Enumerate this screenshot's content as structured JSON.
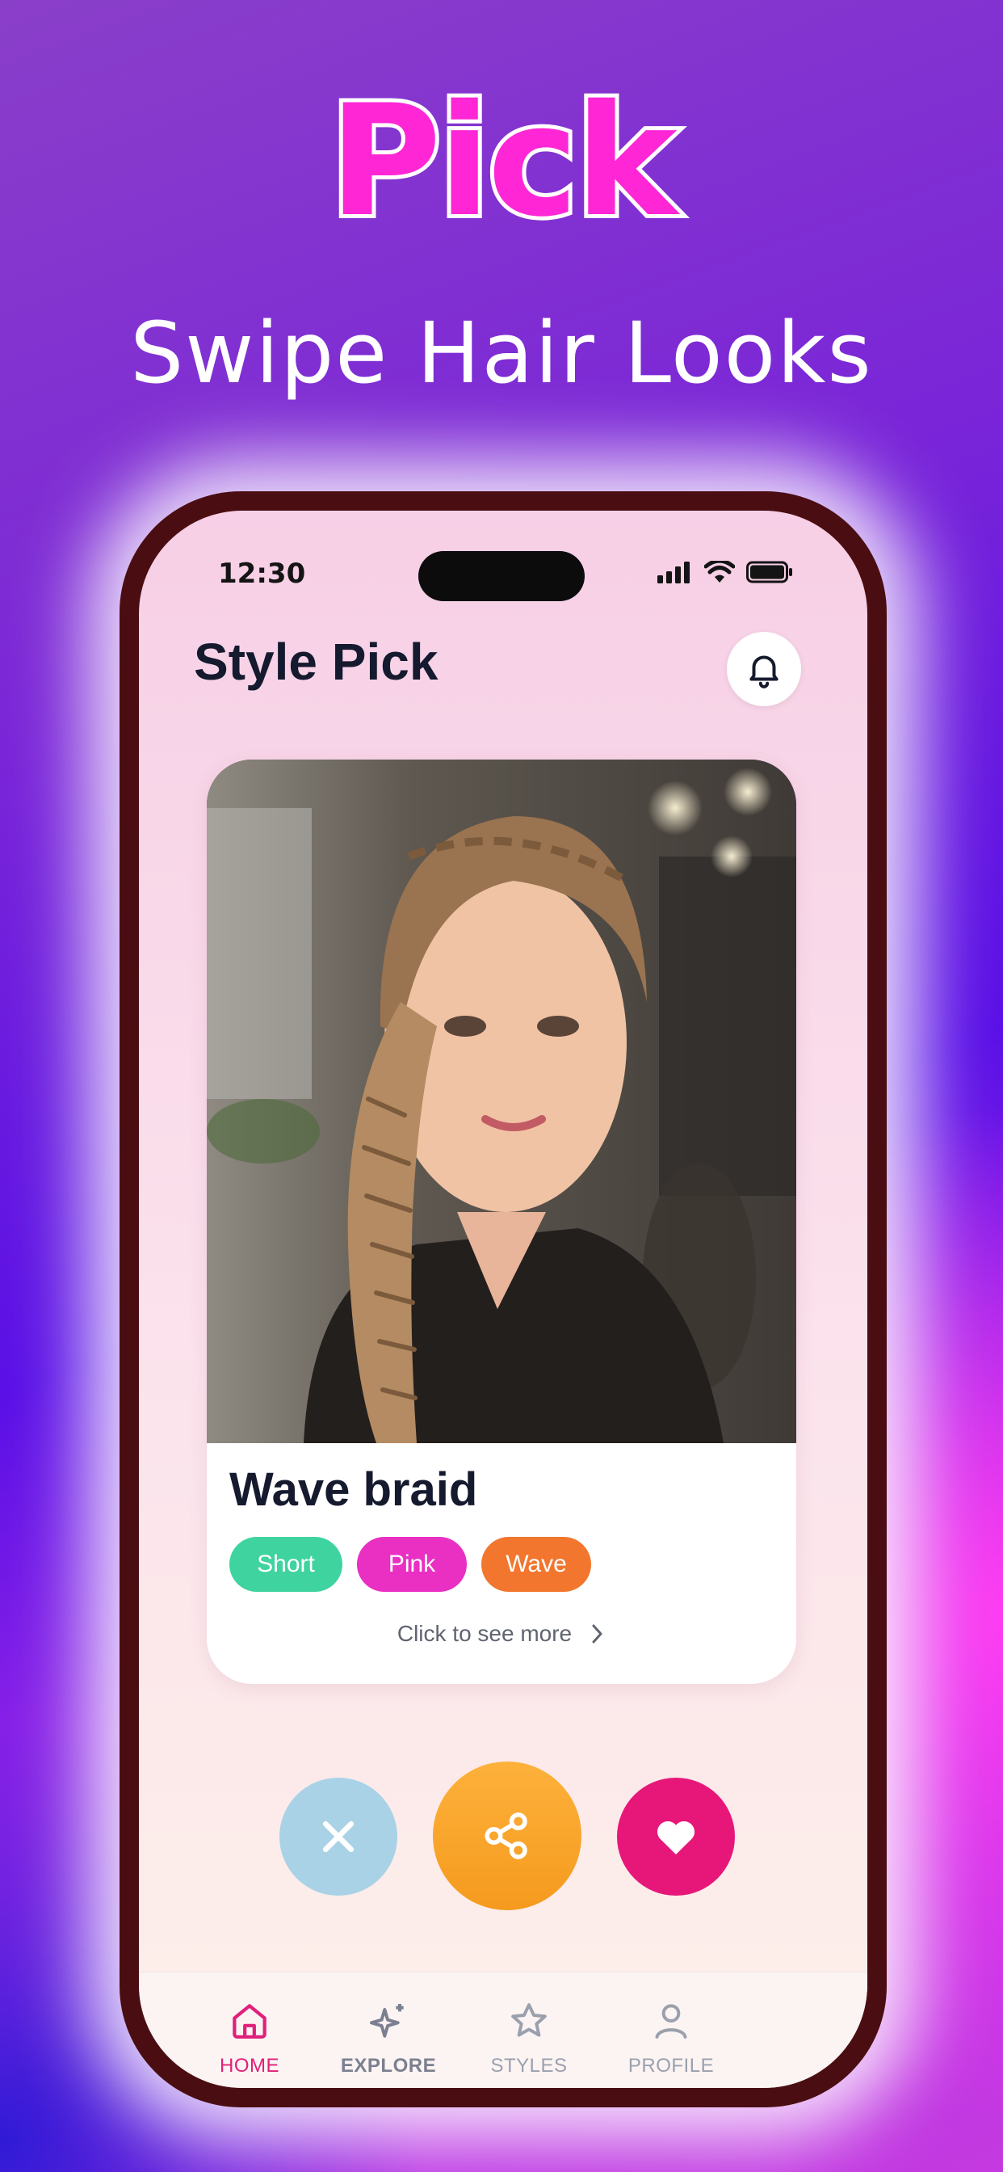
{
  "promo": {
    "title": "Pick",
    "subtitle": "Swipe Hair Looks"
  },
  "status_bar": {
    "time": "12:30",
    "icons": [
      "signal-icon",
      "wifi-icon",
      "battery-icon"
    ]
  },
  "header": {
    "title": "Style Pick",
    "notification_icon": "bell-icon"
  },
  "card": {
    "style_name": "Wave braid",
    "tags": [
      {
        "label": "Short",
        "color": "#3fd3a0"
      },
      {
        "label": "Pink",
        "color": "#ea2fc3"
      },
      {
        "label": "Wave",
        "color": "#f2762e"
      }
    ],
    "see_more_label": "Click to see more",
    "see_more_icon": "chevron-right-icon"
  },
  "actions": {
    "skip_icon": "close-icon",
    "share_icon": "share-icon",
    "like_icon": "heart-icon"
  },
  "tab_bar": {
    "items": [
      {
        "label": "HOME",
        "icon": "home-icon",
        "active": true
      },
      {
        "label": "EXPLORE",
        "icon": "sparkles-icon",
        "active": false
      },
      {
        "label": "STYLES",
        "icon": "star-icon",
        "active": false
      },
      {
        "label": "PROFILE",
        "icon": "user-icon",
        "active": false
      }
    ]
  },
  "colors": {
    "brand_pink": "#e0207a",
    "title_pink": "#ff26d6",
    "share_orange": "#f59a1e",
    "skip_blue": "#a9d2e6",
    "phone_frame": "#4a0e12"
  }
}
